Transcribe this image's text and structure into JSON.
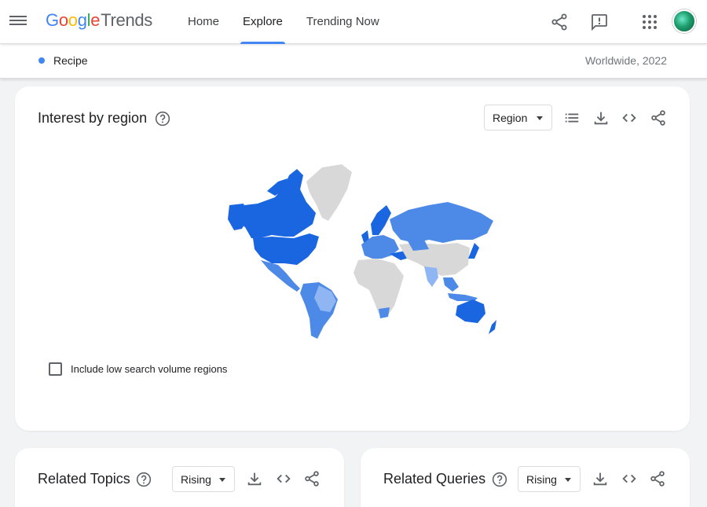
{
  "app": {
    "logo_google": "Google",
    "logo_product": "Trends"
  },
  "nav": {
    "items": [
      {
        "label": "Home",
        "active": false
      },
      {
        "label": "Explore",
        "active": true
      },
      {
        "label": "Trending Now",
        "active": false
      }
    ]
  },
  "header_icons": [
    "share-icon",
    "feedback-icon",
    "apps-grid-icon",
    "avatar"
  ],
  "search_term": {
    "label": "Recipe",
    "color": "#4285f4",
    "scope": "Worldwide, 2022"
  },
  "interest_by_region": {
    "title": "Interest by region",
    "dropdown_label": "Region",
    "tools": [
      "list-icon",
      "download-icon",
      "embed-code-icon",
      "share-icon"
    ],
    "checkbox_label": "Include low search volume regions",
    "checkbox_checked": false,
    "map_colors": {
      "high": "#1a66e0",
      "mid": "#4d8ae8",
      "low": "#8fb5f2",
      "none": "#d8d8d8"
    }
  },
  "related_topics": {
    "title": "Related Topics",
    "dropdown_label": "Rising"
  },
  "related_queries": {
    "title": "Related Queries",
    "dropdown_label": "Rising"
  }
}
